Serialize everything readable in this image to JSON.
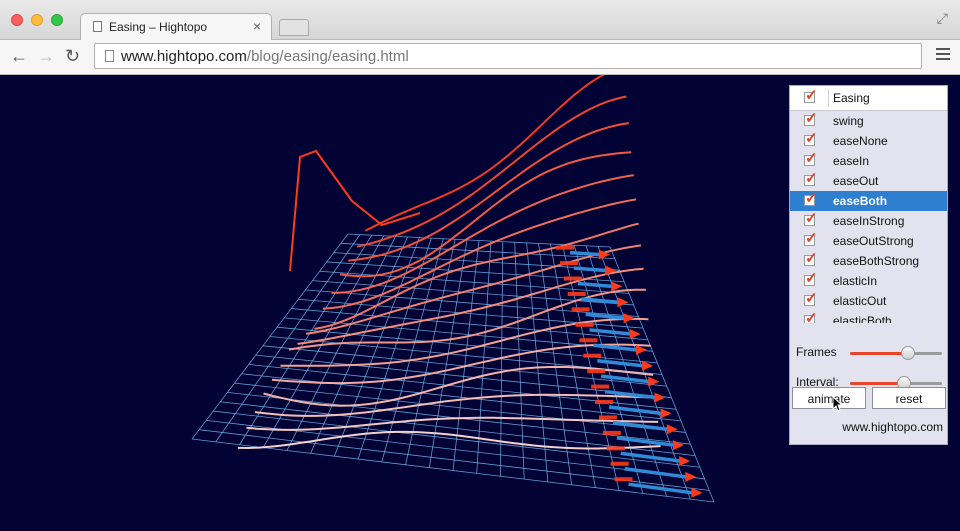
{
  "browser": {
    "tab_title": "Easing – Hightopo",
    "tab_close": "×",
    "url_host": "www.hightopo.com",
    "url_path": "/blog/easing/easing.html"
  },
  "icons": {
    "back": "arrow-left-icon",
    "forward": "arrow-right-icon",
    "reload": "reload-icon",
    "menu": "hamburger-menu-icon",
    "page": "document-icon",
    "cursor": "mouse-pointer-icon"
  },
  "colors": {
    "background": "#020235",
    "grid": "#6fb6ea",
    "curve_hot": "#ff3a1a",
    "curve_cold": "#ffffff",
    "arrow_blue": "#2f8ad8",
    "arrow_head": "#ff3a1a",
    "accent": "#e8452c",
    "selection": "#2f7fd0"
  },
  "panel": {
    "header": {
      "label": "Easing",
      "checked": true
    },
    "items": [
      {
        "label": "swing",
        "checked": true,
        "selected": false
      },
      {
        "label": "easeNone",
        "checked": true,
        "selected": false
      },
      {
        "label": "easeIn",
        "checked": true,
        "selected": false
      },
      {
        "label": "easeOut",
        "checked": true,
        "selected": false
      },
      {
        "label": "easeBoth",
        "checked": true,
        "selected": true
      },
      {
        "label": "easeInStrong",
        "checked": true,
        "selected": false
      },
      {
        "label": "easeOutStrong",
        "checked": true,
        "selected": false
      },
      {
        "label": "easeBothStrong",
        "checked": true,
        "selected": false
      },
      {
        "label": "elasticIn",
        "checked": true,
        "selected": false
      },
      {
        "label": "elasticOut",
        "checked": true,
        "selected": false
      },
      {
        "label": "elasticBoth",
        "checked": true,
        "selected": false
      }
    ],
    "frames": {
      "label": "Frames",
      "value": 0.63
    },
    "interval": {
      "label": "Interval:",
      "value": 0.59
    },
    "animate_label": "animate",
    "reset_label": "reset",
    "credit": "www.hightopo.com"
  }
}
